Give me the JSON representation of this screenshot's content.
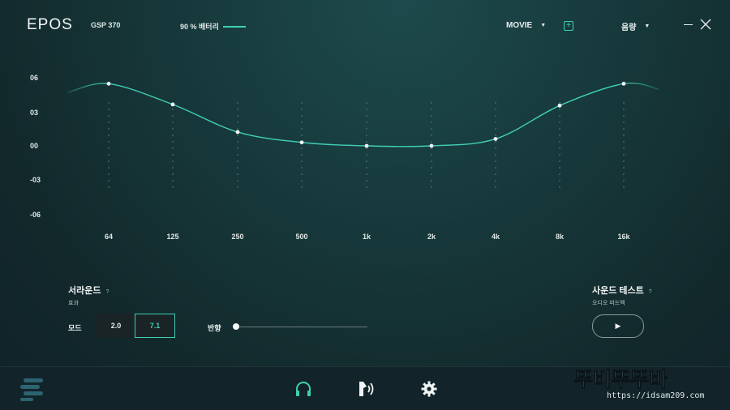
{
  "header": {
    "logo": "EPOS",
    "device": "GSP 370",
    "battery": "90 % 배터리",
    "preset": "MOVIE",
    "volume": "음량"
  },
  "equalizer": {
    "y_labels": [
      "06",
      "03",
      "00",
      "-03",
      "-06"
    ],
    "x_labels": [
      "64",
      "125",
      "250",
      "500",
      "1k",
      "2k",
      "4k",
      "8k",
      "16k"
    ],
    "gains": [
      5.4,
      3.6,
      1.2,
      0.3,
      0.0,
      0.0,
      0.6,
      3.5,
      5.4
    ],
    "accent_color": "#3fd0b6"
  },
  "surround": {
    "title": "서라운드",
    "help": "?",
    "subtitle": "효과",
    "mode_label": "모드",
    "modes": [
      "2.0",
      "7.1"
    ],
    "selected_mode": "7.1",
    "direction_label": "반향",
    "direction_value": 0
  },
  "sound_test": {
    "title": "사운드 테스트",
    "help": "?",
    "subtitle": "오디오 피드백",
    "play": "▶"
  },
  "nav": {
    "icons": [
      "menu-icon",
      "headphones-icon",
      "voice-icon",
      "gear-icon"
    ],
    "active": "headphones-icon"
  },
  "watermark": {
    "text": "뚜비뚜뚜바",
    "url": "https://idsam209.com"
  }
}
